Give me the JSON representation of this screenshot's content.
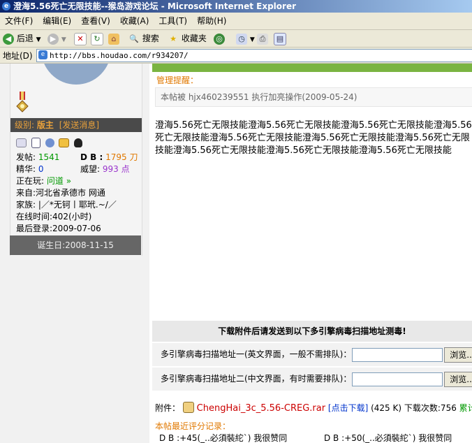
{
  "window": {
    "title": "澄海5.56死亡无限技能--猴岛游戏论坛 - Microsoft Internet Explorer"
  },
  "menu": [
    "文件(F)",
    "编辑(E)",
    "查看(V)",
    "收藏(A)",
    "工具(T)",
    "帮助(H)"
  ],
  "toolbar": {
    "back": "后退",
    "search": "搜索",
    "favorites": "收藏夹"
  },
  "address": {
    "label": "地址(D)",
    "url": "http://bbs.houdao.com/r934207/"
  },
  "user": {
    "level_label": "级别:",
    "level": "版主",
    "send_msg": "[发送消息]",
    "posts_label": "发帖:",
    "posts": "1541",
    "db_label": "D B :",
    "db": "1795 刀",
    "elite_label": "精华:",
    "elite": "0",
    "prestige_label": "威望:",
    "prestige": "993 点",
    "playing_label": "正在玩:",
    "playing": "问道 »",
    "from": "来自:河北省承德市 网通",
    "clan": "家族: |／*无钶丨耶玳.~/／",
    "online": "在线时间:402(小时)",
    "last_login": "最后登录:2009-07-06",
    "birthday": "诞生日:2008-11-15"
  },
  "admin_notice": {
    "label": "管理提醒：",
    "text": "本帖被  hjx460239551 执行加亮操作(2009-05-24)"
  },
  "post": {
    "body": "澄海5.56死亡无限技能澄海5.56死亡无限技能澄海5.56死亡无限技能澄海5.56死亡无限技能澄海5.56死亡无限技能澄海5.56死亡无限技能澄海5.56死亡无限技能澄海5.56死亡无限技能澄海5.56死亡无限技能澄海5.56死亡无限技能"
  },
  "download": {
    "heading": "下载附件后请发送到以下多引擎病毒扫描地址测毒!",
    "scan1": "多引擎病毒扫描地址一(英文界面，一般不需排队)：",
    "scan2": "多引擎病毒扫描地址二(中文界面，有时需要排队)：",
    "browse": "浏览..."
  },
  "attachment": {
    "label": "附件：",
    "filename": "ChengHai_3c_5.56-CREG.rar",
    "click": "[点击下载]",
    "size": "(425 K)",
    "count": "下载次数:756",
    "more": "累计下载"
  },
  "ratings": {
    "title": "本帖最近评分记录：",
    "items": [
      "D B :+45(_..必須裝紽`) 我很赞同",
      "D B :+50(_..必須裝紽`) 我很赞同"
    ]
  },
  "colors": {
    "title_bar": "#0a246a",
    "accent_orange": "#e07800",
    "link_blue": "#0033cc",
    "green": "#009900"
  }
}
